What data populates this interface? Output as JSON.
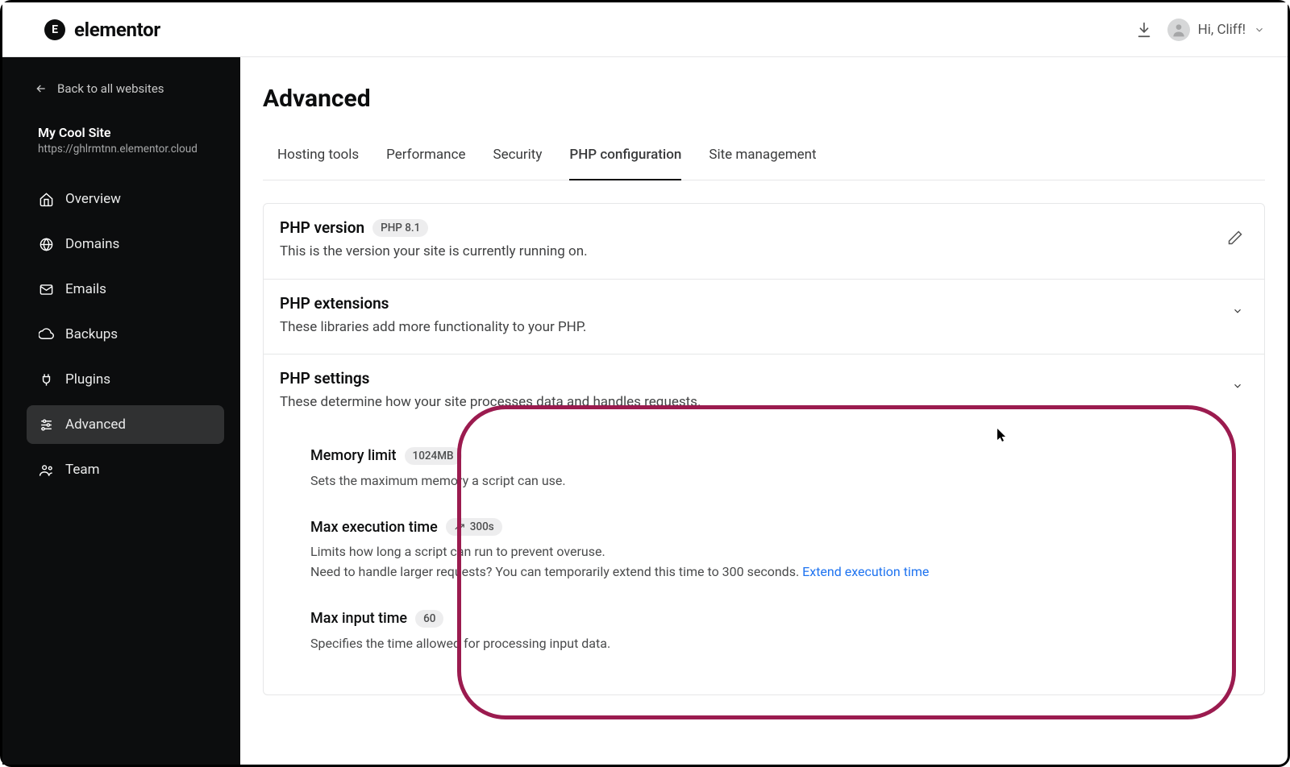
{
  "brand": {
    "mark": "E",
    "name": "elementor"
  },
  "header": {
    "greeting": "Hi, Cliff!"
  },
  "sidebar": {
    "back_label": "Back to all websites",
    "site_name": "My Cool Site",
    "site_url": "https://ghlrmtnn.elementor.cloud",
    "nav": [
      {
        "icon": "home",
        "label": "Overview"
      },
      {
        "icon": "globe",
        "label": "Domains"
      },
      {
        "icon": "mail",
        "label": "Emails"
      },
      {
        "icon": "backup",
        "label": "Backups"
      },
      {
        "icon": "plugin",
        "label": "Plugins"
      },
      {
        "icon": "advanced",
        "label": "Advanced"
      },
      {
        "icon": "team",
        "label": "Team"
      }
    ]
  },
  "page": {
    "title": "Advanced",
    "tabs": [
      "Hosting tools",
      "Performance",
      "Security",
      "PHP configuration",
      "Site management"
    ],
    "active_tab": "PHP configuration"
  },
  "panels": {
    "php_version": {
      "title": "PHP version",
      "badge": "PHP 8.1",
      "desc": "This is the version your site is currently running on."
    },
    "php_extensions": {
      "title": "PHP extensions",
      "desc": "These libraries add more functionality to your PHP."
    },
    "php_settings": {
      "title": "PHP settings",
      "desc": "These determine how your site processes data and handles requests.",
      "memory": {
        "title": "Memory limit",
        "value": "1024MB",
        "desc": "Sets the maximum memory a script can use."
      },
      "max_exec": {
        "title": "Max execution time",
        "value": "300s",
        "desc1": "Limits how long a script can run to prevent overuse.",
        "desc2": "Need to handle larger requests? You can temporarily extend this time to 300 seconds. ",
        "link": "Extend execution time"
      },
      "max_input": {
        "title": "Max input time",
        "value": "60",
        "desc": "Specifies the time allowed for processing input data."
      }
    }
  }
}
